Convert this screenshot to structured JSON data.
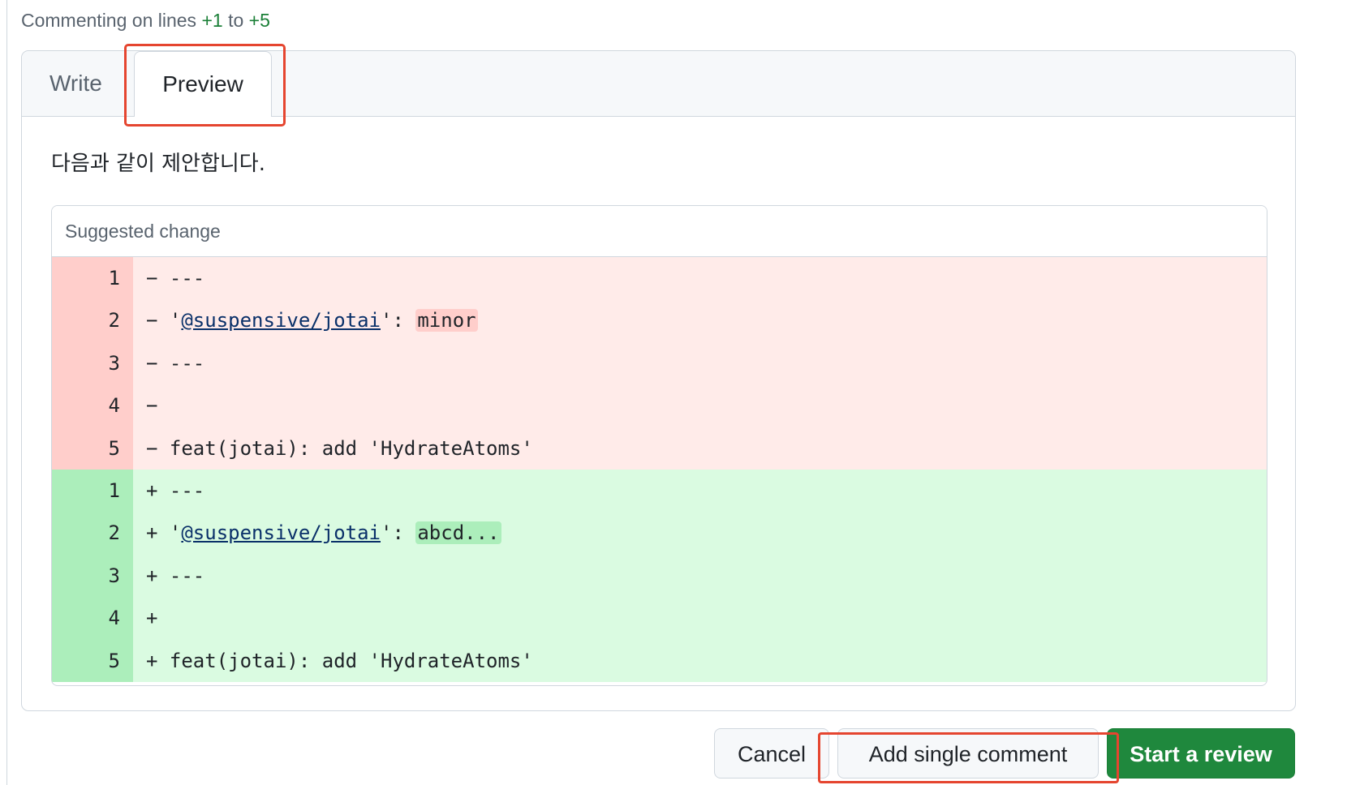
{
  "header": {
    "commenting_prefix": "Commenting on lines",
    "from_line": "+1",
    "to_word": "to",
    "to_line": "+5"
  },
  "tabs": {
    "write": "Write",
    "preview": "Preview",
    "active": "Preview"
  },
  "comment": {
    "body": "다음과 같이 제안합니다."
  },
  "suggestion": {
    "header": "Suggested change",
    "removed": [
      {
        "num": "1",
        "prefix": "−",
        "text": " ---"
      },
      {
        "num": "2",
        "prefix": "−",
        "quote_open": " '",
        "link": "@suspensive/jotai",
        "quote_close": "': ",
        "mark": "minor"
      },
      {
        "num": "3",
        "prefix": "−",
        "text": " ---"
      },
      {
        "num": "4",
        "prefix": "−",
        "text": ""
      },
      {
        "num": "5",
        "prefix": "−",
        "text": " feat(jotai): add 'HydrateAtoms'"
      }
    ],
    "added": [
      {
        "num": "1",
        "prefix": "+",
        "text": " ---"
      },
      {
        "num": "2",
        "prefix": "+",
        "quote_open": " '",
        "link": "@suspensive/jotai",
        "quote_close": "': ",
        "mark": "abcd..."
      },
      {
        "num": "3",
        "prefix": "+",
        "text": " ---"
      },
      {
        "num": "4",
        "prefix": "+",
        "text": ""
      },
      {
        "num": "5",
        "prefix": "+",
        "text": " feat(jotai): add 'HydrateAtoms'"
      }
    ]
  },
  "actions": {
    "cancel": "Cancel",
    "add_single": "Add single comment",
    "start_review": "Start a review"
  },
  "colors": {
    "primary_button": "#1f883d",
    "annotation_highlight": "#e5452f",
    "deleted_bg": "#ffebe9",
    "added_bg": "#dafbe1"
  }
}
